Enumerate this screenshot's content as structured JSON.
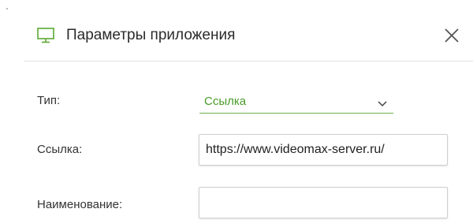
{
  "dialog": {
    "title": "Параметры приложения",
    "title_icon": "monitor-icon",
    "close_icon": "close-icon",
    "accent_color": "#4a9a2a"
  },
  "form": {
    "type_label": "Тип:",
    "type_value": "Ссылка",
    "link_label": "Ссылка:",
    "link_value": "https://www.videomax-server.ru/",
    "name_label": "Наименование:",
    "name_value": ""
  }
}
